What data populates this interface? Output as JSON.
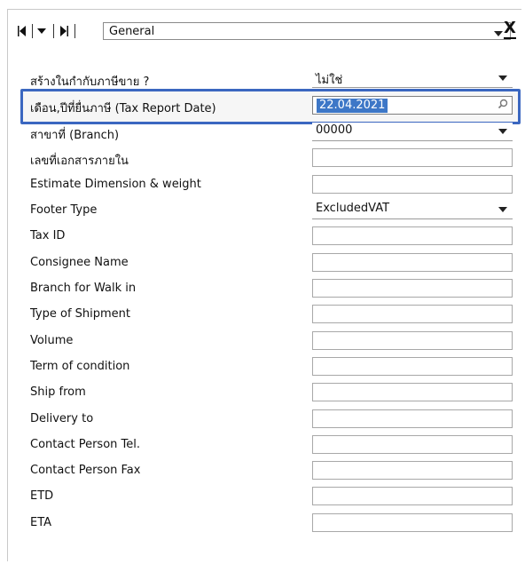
{
  "header": {
    "nav": [
      "first-icon",
      "dropdown-icon",
      "last-icon"
    ],
    "category_value": "General",
    "close_label": "X"
  },
  "fields": [
    {
      "label": "สร้างในกำกับภาษีขาย ?",
      "value": "ไม่ใช่",
      "type": "combo"
    },
    {
      "label": "เดือน,ปีที่ยื่นภาษี (Tax Report Date)",
      "value": "22.04.2021",
      "type": "date",
      "focused": true
    },
    {
      "label": "สาขาที่ (Branch)",
      "value": "00000",
      "type": "combo"
    },
    {
      "label": "เลขที่เอกสารภายใน",
      "value": "",
      "type": "text"
    },
    {
      "label": "Estimate Dimension & weight",
      "value": "",
      "type": "text"
    },
    {
      "label": "Footer Type",
      "value": "ExcludedVAT",
      "type": "combo"
    },
    {
      "label": "Tax ID",
      "value": "",
      "type": "text"
    },
    {
      "label": "Consignee Name",
      "value": "",
      "type": "text"
    },
    {
      "label": "Branch for Walk in",
      "value": "",
      "type": "text"
    },
    {
      "label": "Type of Shipment",
      "value": "",
      "type": "text"
    },
    {
      "label": "Volume",
      "value": "",
      "type": "text"
    },
    {
      "label": "Term of condition",
      "value": "",
      "type": "text"
    },
    {
      "label": "Ship from",
      "value": "",
      "type": "text"
    },
    {
      "label": "Delivery to",
      "value": "",
      "type": "text"
    },
    {
      "label": "Contact Person Tel.",
      "value": "",
      "type": "text"
    },
    {
      "label": "Contact Person Fax",
      "value": "",
      "type": "text"
    },
    {
      "label": "ETD",
      "value": "",
      "type": "text"
    },
    {
      "label": "ETA",
      "value": "",
      "type": "text"
    }
  ],
  "colors": {
    "focus_border": "#3b67c0",
    "selection": "#3d77c7"
  }
}
